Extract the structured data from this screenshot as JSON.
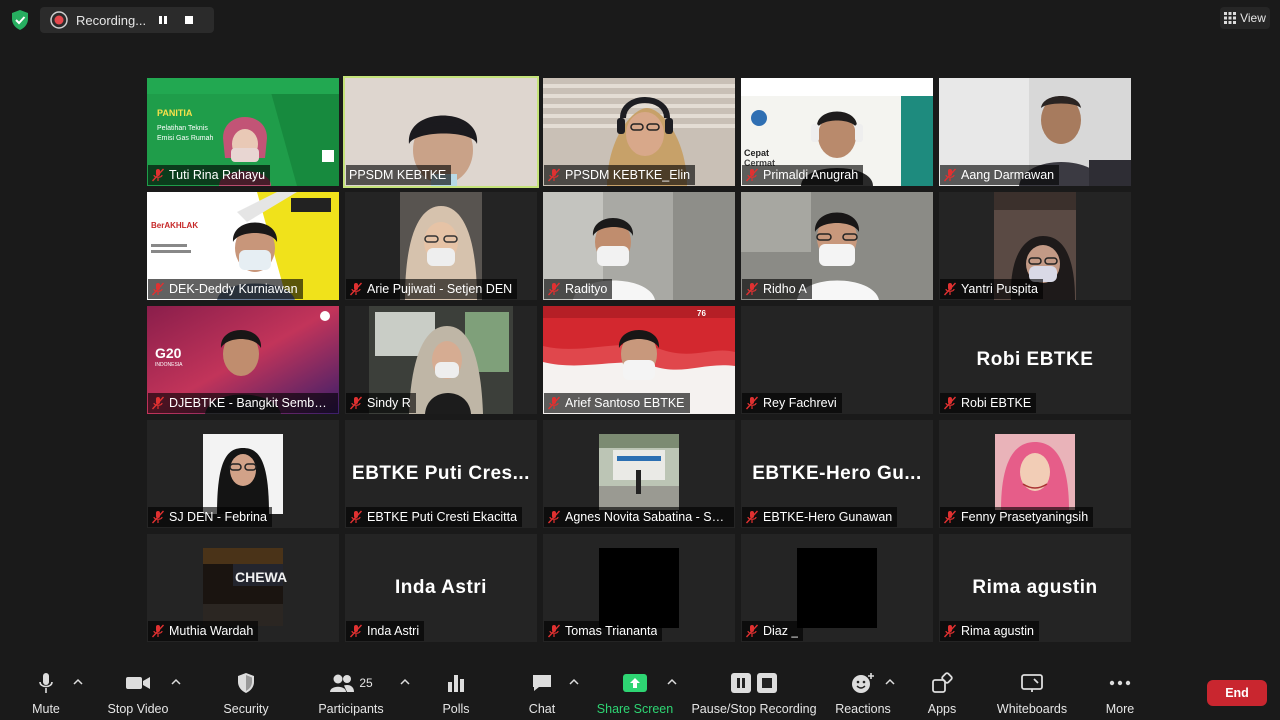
{
  "recording": {
    "label": "Recording..."
  },
  "view_button": {
    "label": "View"
  },
  "tiles": [
    {
      "name": "Tuti Rina Rahayu",
      "big": ""
    },
    {
      "name": "PPSDM KEBTKE",
      "big": ""
    },
    {
      "name": "PPSDM KEBTKE_Elin",
      "big": ""
    },
    {
      "name": "Primaldi Anugrah",
      "big": ""
    },
    {
      "name": "Aang Darmawan",
      "big": ""
    },
    {
      "name": "DEK-Deddy Kurniawan",
      "big": ""
    },
    {
      "name": "Arie Pujiwati - Setjen DEN",
      "big": ""
    },
    {
      "name": "Radityo",
      "big": ""
    },
    {
      "name": "Ridho A",
      "big": ""
    },
    {
      "name": "Yantri Puspita",
      "big": ""
    },
    {
      "name": "DJEBTKE - Bangkit Sembodo",
      "big": ""
    },
    {
      "name": "Sindy R",
      "big": ""
    },
    {
      "name": "Arief Santoso EBTKE",
      "big": ""
    },
    {
      "name": "Rey Fachrevi",
      "big": ""
    },
    {
      "name": "Robi EBTKE",
      "big": "Robi EBTKE"
    },
    {
      "name": "SJ DEN - Febrina",
      "big": ""
    },
    {
      "name": "EBTKE Puti Cresti Ekacitta",
      "big": "EBTKE  Puti  Cres..."
    },
    {
      "name": "Agnes Novita Sabatina - Setj...",
      "big": ""
    },
    {
      "name": "EBTKE-Hero Gunawan",
      "big": "EBTKE-Hero  Gu..."
    },
    {
      "name": "Fenny Prasetyaningsih",
      "big": ""
    },
    {
      "name": "Muthia Wardah",
      "big": ""
    },
    {
      "name": "Inda Astri",
      "big": "Inda Astri"
    },
    {
      "name": "Tomas Triananta",
      "big": ""
    },
    {
      "name": "Diaz _",
      "big": ""
    },
    {
      "name": "Rima agustin",
      "big": "Rima agustin"
    }
  ],
  "slide_text": {
    "panitia": "PANITIA",
    "pelatihan": "Pelatihan Teknis",
    "emisi": "Emisi Gas Rumah",
    "berakhlak": "BerAKHLAK",
    "cepat": "Cepat",
    "cermat": "Cermat",
    "g20": "G20",
    "indonesia": "INDONESIA",
    "chewa": "CHEWA"
  },
  "toolbar": {
    "mute": "Mute",
    "stop_video": "Stop Video",
    "security": "Security",
    "participants": "Participants",
    "participants_count": "25",
    "polls": "Polls",
    "chat": "Chat",
    "share_screen": "Share Screen",
    "pause_stop_recording": "Pause/Stop Recording",
    "reactions": "Reactions",
    "apps": "Apps",
    "whiteboards": "Whiteboards",
    "more": "More",
    "end": "End"
  },
  "colors": {
    "share_green": "#2ed573",
    "end_red": "#c9262f",
    "active_speaker": "#c5e37a",
    "mic_muted": "#e03131"
  }
}
